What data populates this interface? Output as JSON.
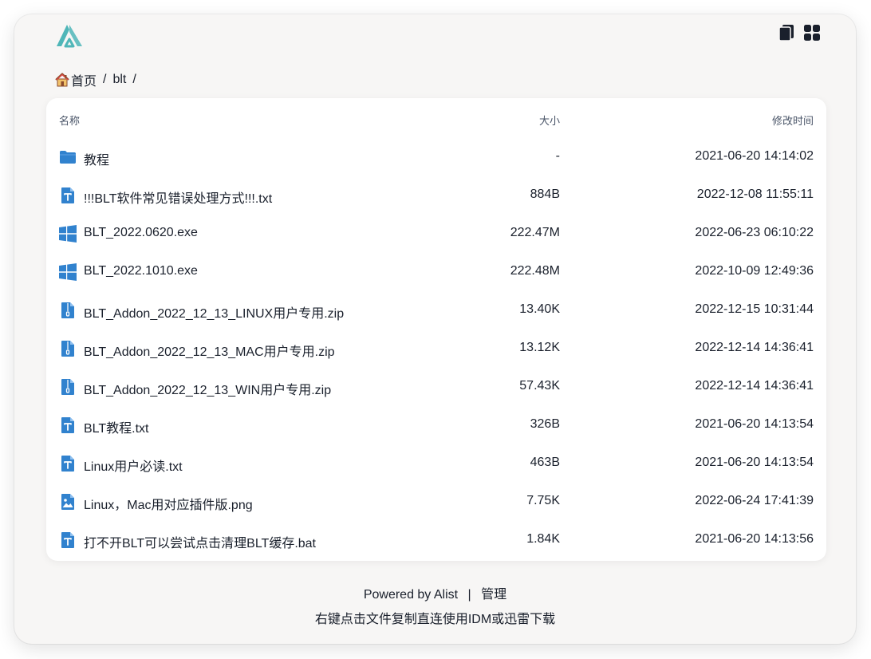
{
  "header": {
    "logo_icon": "alist-logo-icon",
    "actions": [
      {
        "icon": "copy-icon"
      },
      {
        "icon": "grid-view-icon"
      }
    ]
  },
  "breadcrumb": {
    "home_icon": "house-icon",
    "items": [
      "首页",
      "blt"
    ],
    "separator": "/"
  },
  "table": {
    "columns": {
      "name": "名称",
      "size": "大小",
      "modified": "修改时间"
    },
    "rows": [
      {
        "icon": "folder-icon",
        "name": "教程",
        "size": "-",
        "modified": "2021-06-20 14:14:02"
      },
      {
        "icon": "text-file-icon",
        "name": "!!!BLT软件常见错误处理方式!!!.txt",
        "size": "884B",
        "modified": "2022-12-08 11:55:11"
      },
      {
        "icon": "windows-icon",
        "name": "BLT_2022.0620.exe",
        "size": "222.47M",
        "modified": "2022-06-23 06:10:22"
      },
      {
        "icon": "windows-icon",
        "name": "BLT_2022.1010.exe",
        "size": "222.48M",
        "modified": "2022-10-09 12:49:36"
      },
      {
        "icon": "zip-file-icon",
        "name": "BLT_Addon_2022_12_13_LINUX用户专用.zip",
        "size": "13.40K",
        "modified": "2022-12-15 10:31:44"
      },
      {
        "icon": "zip-file-icon",
        "name": "BLT_Addon_2022_12_13_MAC用户专用.zip",
        "size": "13.12K",
        "modified": "2022-12-14 14:36:41"
      },
      {
        "icon": "zip-file-icon",
        "name": "BLT_Addon_2022_12_13_WIN用户专用.zip",
        "size": "57.43K",
        "modified": "2022-12-14 14:36:41"
      },
      {
        "icon": "text-file-icon",
        "name": "BLT教程.txt",
        "size": "326B",
        "modified": "2021-06-20 14:13:54"
      },
      {
        "icon": "text-file-icon",
        "name": "Linux用户必读.txt",
        "size": "463B",
        "modified": "2021-06-20 14:13:54"
      },
      {
        "icon": "image-file-icon",
        "name": "Linux，Mac用对应插件版.png",
        "size": "7.75K",
        "modified": "2022-06-24 17:41:39"
      },
      {
        "icon": "text-file-icon",
        "name": "打不开BLT可以尝试点击清理BLT缓存.bat",
        "size": "1.84K",
        "modified": "2021-06-20 14:13:56"
      }
    ]
  },
  "footer": {
    "powered_by": "Powered by Alist",
    "separator": "|",
    "manage": "管理",
    "note": "右键点击文件复制直连使用IDM或迅雷下载"
  },
  "colors": {
    "accent": "#3182ce",
    "logo": "#4fb6b8",
    "background": "#f7f6f5",
    "panel": "#ffffff"
  }
}
